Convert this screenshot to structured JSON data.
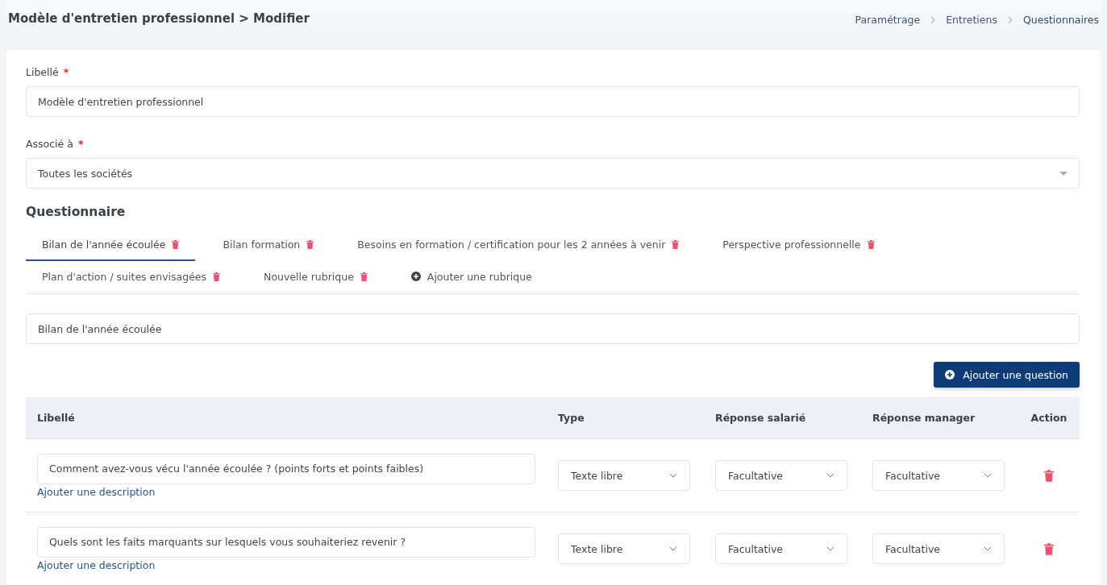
{
  "header": {
    "title": "Modèle d'entretien professionnel > Modifier",
    "breadcrumb": [
      "Paramétrage",
      "Entretiens",
      "Questionnaires"
    ]
  },
  "form": {
    "libelle": {
      "label": "Libellé",
      "required_mark": "*",
      "value": "Modèle d'entretien professionnel"
    },
    "associe": {
      "label": "Associé à",
      "required_mark": "*",
      "value": "Toutes les sociétés"
    }
  },
  "questionnaire": {
    "title": "Questionnaire",
    "tabs": [
      {
        "kind": "section",
        "label": "Bilan de l'année écoulée",
        "selected": true
      },
      {
        "kind": "section",
        "label": "Bilan formation",
        "selected": false
      },
      {
        "kind": "section",
        "label": "Besoins en formation / certification pour les 2 années à venir",
        "selected": false
      },
      {
        "kind": "section",
        "label": "Perspective professionnelle",
        "selected": false
      },
      {
        "kind": "section",
        "label": "Plan d'action / suites envisagées",
        "selected": false
      },
      {
        "kind": "section",
        "label": "Nouvelle rubrique",
        "selected": false
      },
      {
        "kind": "add",
        "label": "Ajouter une rubrique",
        "selected": false
      }
    ],
    "section_name": "Bilan de l'année écoulée",
    "add_question": "Ajouter une question",
    "table": {
      "columns": [
        "Libellé",
        "Type",
        "Réponse salarié",
        "Réponse manager",
        "Action"
      ],
      "rows": [
        {
          "question": "Comment avez-vous vécu l'année écoulée ? (points forts et points faibles)",
          "description_link": "Ajouter une description",
          "type": "Texte libre",
          "employee": "Facultative",
          "manager": "Facultative"
        },
        {
          "question": "Quels sont les faits marquants sur lesquels vous souhaiteriez revenir ?",
          "description_link": "Ajouter une description",
          "type": "Texte libre",
          "employee": "Facultative",
          "manager": "Facultative"
        }
      ]
    }
  }
}
